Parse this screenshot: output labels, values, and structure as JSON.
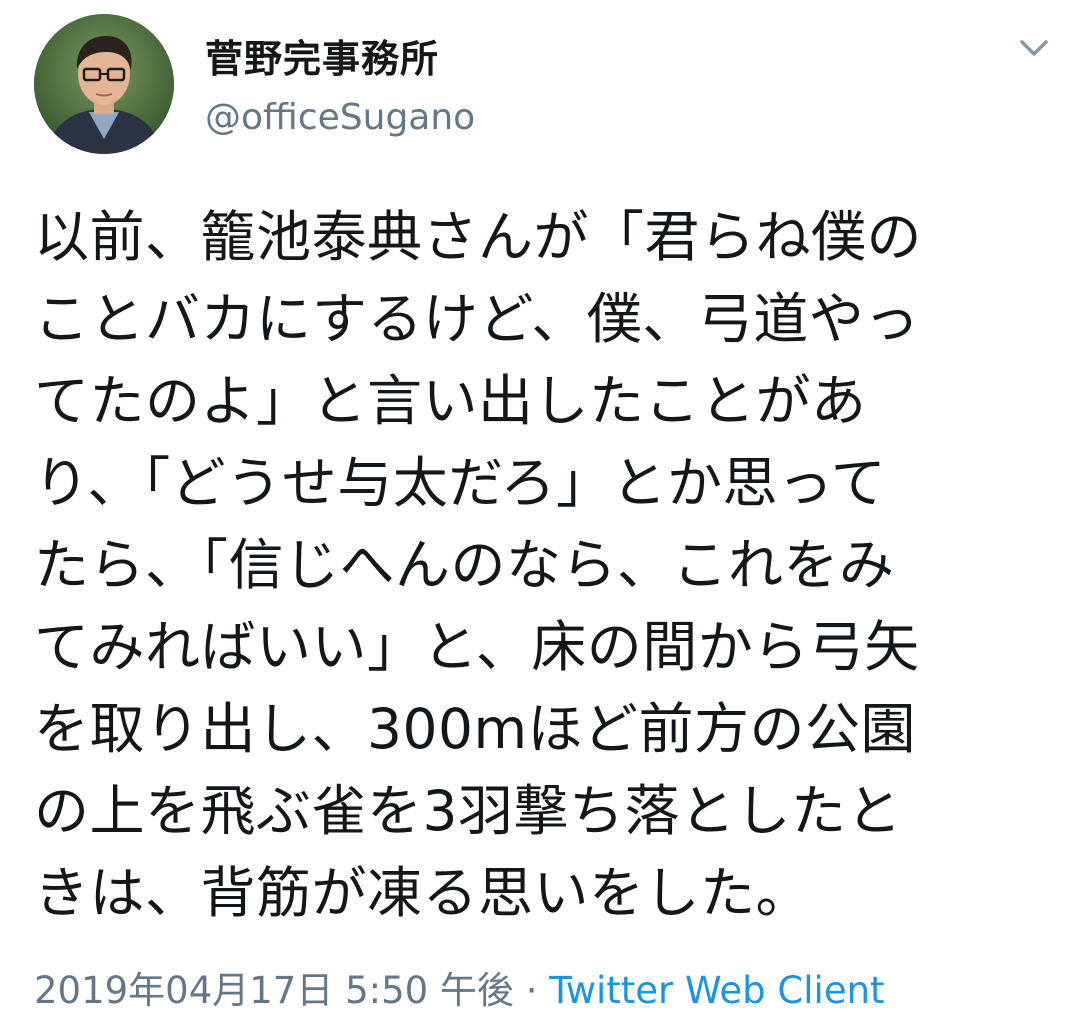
{
  "author": {
    "display_name": "菅野完事務所",
    "handle": "@officeSugano",
    "avatar_icon": "profile-photo"
  },
  "menu": {
    "caret_icon": "chevron-down-icon"
  },
  "tweet": {
    "lines": [
      "以前、籠池泰典さんが「君らね僕の",
      "ことバカにするけど、僕、弓道やっ",
      "てたのよ」と言い出したことがあ",
      "り、「どうせ与太だろ」とか思って",
      "たら、「信じへんのなら、これをみ",
      "てみればいい」と、床の間から弓矢",
      "を取り出し、300mほど前方の公園",
      "の上を飛ぶ雀を3羽撃ち落としたと",
      "きは、背筋が凍る思いをした。"
    ]
  },
  "meta": {
    "timestamp": "2019年04月17日 5:50 午後",
    "separator": "·",
    "source": "Twitter Web Client"
  },
  "colors": {
    "text": "#14171a",
    "secondary": "#657786",
    "link": "#1b95e0"
  }
}
